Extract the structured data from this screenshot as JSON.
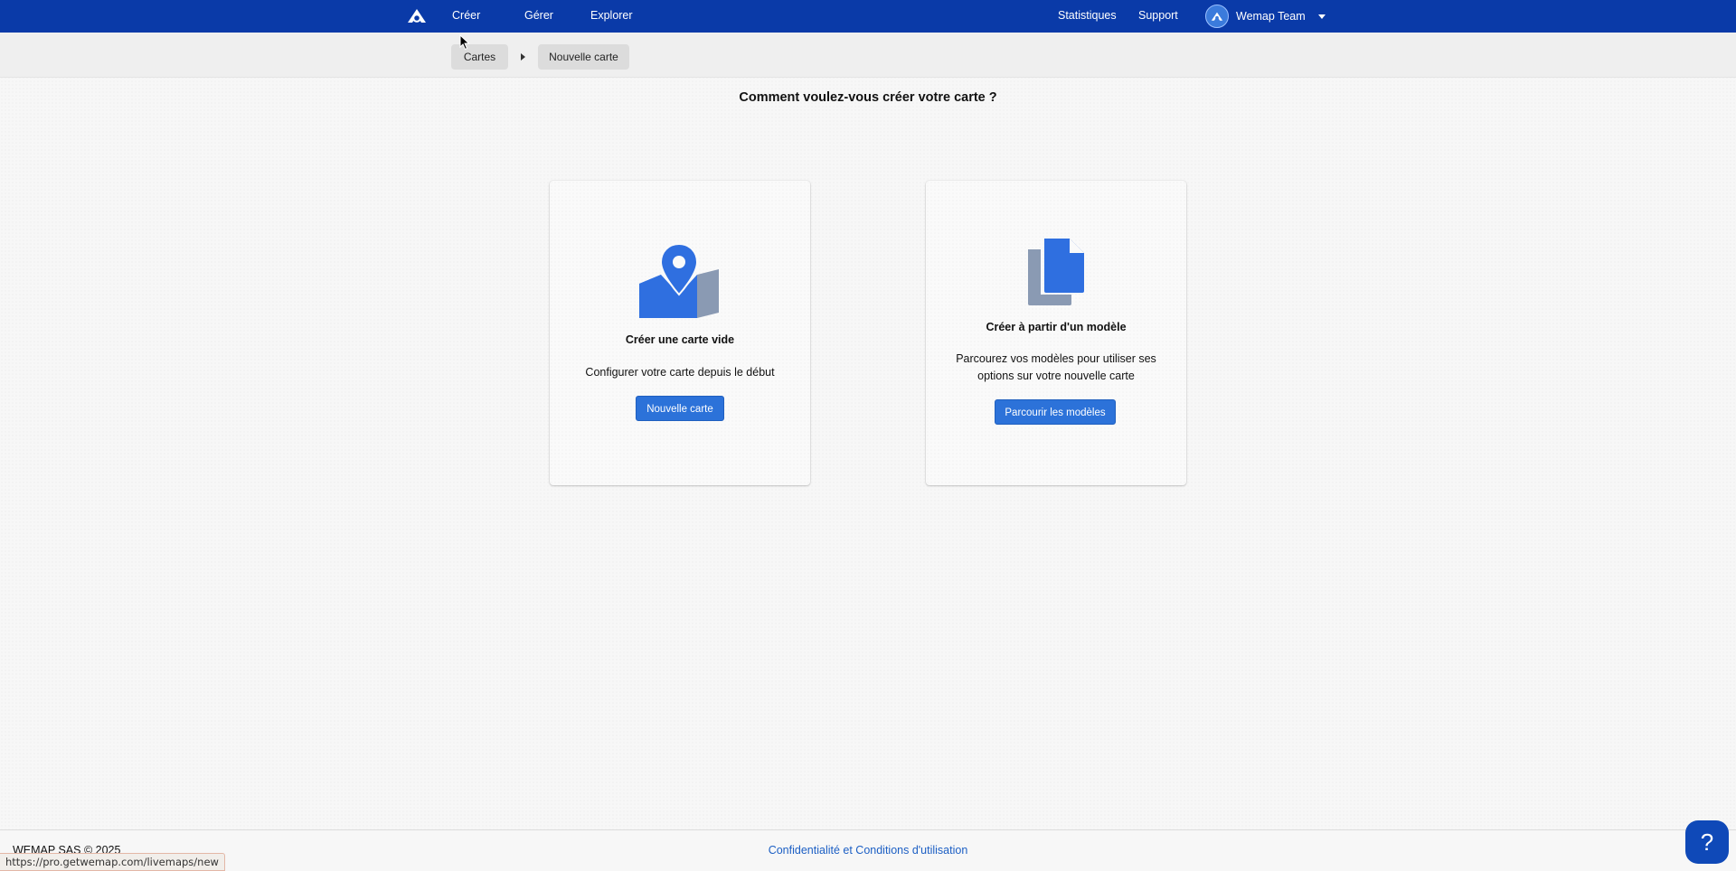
{
  "nav": {
    "logo": "wemap-logo-icon",
    "create": "Créer",
    "manage": "Gérer",
    "explore": "Explorer",
    "statistics": "Statistiques",
    "support": "Support",
    "user_name": "Wemap Team"
  },
  "breadcrumb": {
    "items": [
      "Cartes",
      "Nouvelle carte"
    ]
  },
  "page": {
    "title": "Comment voulez-vous créer votre carte ?"
  },
  "cards": {
    "empty": {
      "icon": "map-pin-icon",
      "title": "Créer une carte vide",
      "description": "Configurer votre carte depuis le début",
      "button": "Nouvelle carte"
    },
    "template": {
      "icon": "copy-document-icon",
      "title": "Créer à partir d'un modèle",
      "description": "Parcourez vos modèles pour utiliser ses options sur votre nouvelle carte",
      "button": "Parcourir les modèles"
    }
  },
  "footer": {
    "copyright": "WEMAP SAS © 2025",
    "legal": "Confidentialité et Conditions d'utilisation"
  },
  "status_bar": {
    "url": "https://pro.getwemap.com/livemaps/new"
  },
  "help": {
    "label": "?"
  },
  "colors": {
    "nav_bg": "#0a3aa8",
    "primary_button": "#2c72d9",
    "icon_blue": "#2f6fe0",
    "icon_gray": "#8a9ab3",
    "link": "#1c5fc4"
  }
}
